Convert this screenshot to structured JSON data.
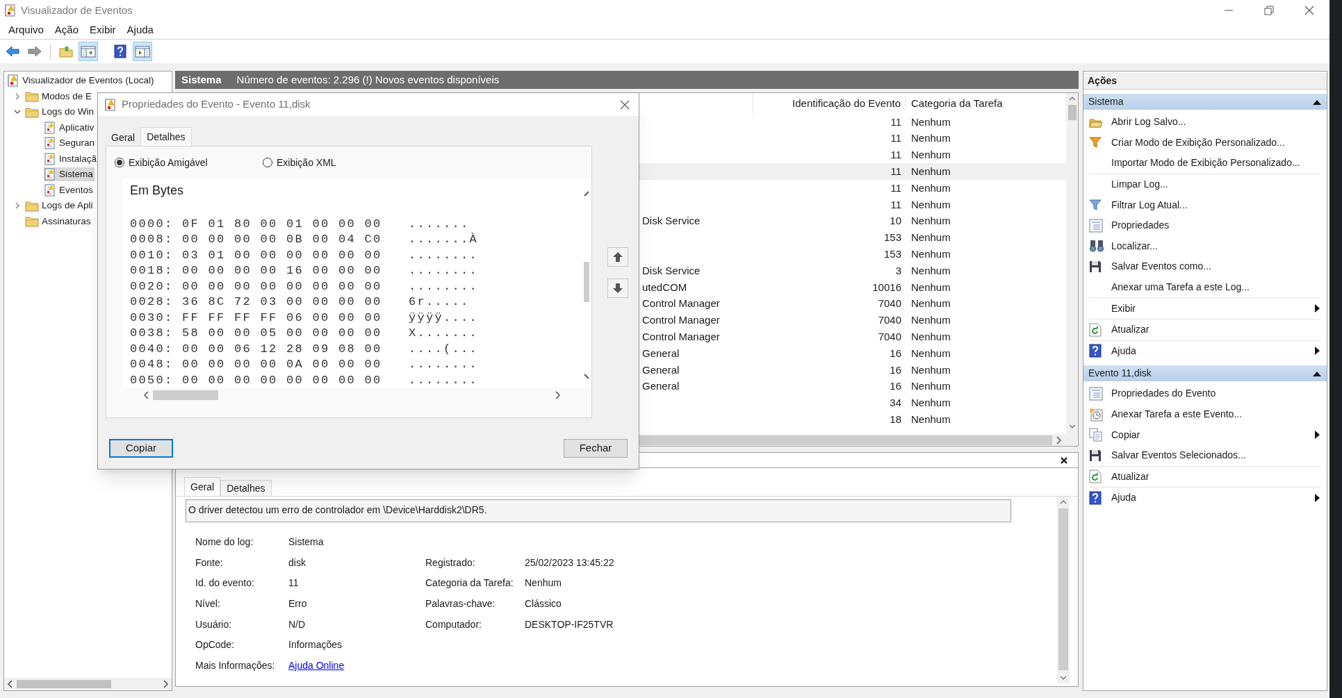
{
  "window": {
    "title": "Visualizador de Eventos"
  },
  "menu": [
    "Arquivo",
    "Ação",
    "Exibir",
    "Ajuda"
  ],
  "toolbar": [
    {
      "on": false
    },
    {
      "on": false
    },
    {
      "on": false
    },
    {
      "on": true
    },
    {
      "on": false
    },
    {
      "on": true
    }
  ],
  "tree": [
    {
      "label": "Visualizador de Eventos (Local)",
      "kind": "root",
      "selected": false,
      "children": [
        {
          "label": "Modos de E",
          "kind": "folder",
          "selected": false,
          "expanded": false
        },
        {
          "label": "Logs do Win",
          "kind": "folder",
          "selected": false,
          "expanded": true,
          "children": [
            {
              "label": "Aplicativ",
              "kind": "log",
              "selected": false
            },
            {
              "label": "Seguran",
              "kind": "log",
              "selected": false
            },
            {
              "label": "Instalaçã",
              "kind": "log",
              "selected": false
            },
            {
              "label": "Sistema",
              "kind": "log",
              "selected": true
            },
            {
              "label": "Eventos",
              "kind": "log",
              "selected": false
            }
          ]
        },
        {
          "label": "Logs de Apli",
          "kind": "folder",
          "selected": false,
          "expanded": false
        },
        {
          "label": "Assinaturas",
          "kind": "folder",
          "selected": false
        }
      ]
    }
  ],
  "log_header": {
    "name": "Sistema",
    "summary": "Número de eventos: 2.296 (!) Novos eventos disponíveis"
  },
  "table": {
    "columns": [
      {
        "label": "Identificação do Evento"
      },
      {
        "label": "Categoria da Tarefa"
      }
    ],
    "rows": [
      {
        "event_id": "11",
        "category": "Nenhum",
        "selected": false
      },
      {
        "event_id": "11",
        "category": "Nenhum",
        "selected": false
      },
      {
        "event_id": "11",
        "category": "Nenhum",
        "selected": false
      },
      {
        "event_id": "11",
        "category": "Nenhum",
        "selected": true
      },
      {
        "event_id": "11",
        "category": "Nenhum",
        "selected": false
      },
      {
        "event_id": "11",
        "category": "Nenhum",
        "selected": false
      },
      {
        "column_1": "Disk Service",
        "event_id": "10",
        "category": "Nenhum",
        "selected": false
      },
      {
        "event_id": "153",
        "category": "Nenhum",
        "selected": false
      },
      {
        "event_id": "153",
        "category": "Nenhum",
        "selected": false
      },
      {
        "column_1": "Disk Service",
        "event_id": "3",
        "category": "Nenhum",
        "selected": false
      },
      {
        "column_1": "utedCOM",
        "event_id": "10016",
        "category": "Nenhum",
        "selected": false
      },
      {
        "column_1": "Control Manager",
        "event_id": "7040",
        "category": "Nenhum",
        "selected": false
      },
      {
        "column_1": "Control Manager",
        "event_id": "7040",
        "category": "Nenhum",
        "selected": false
      },
      {
        "column_1": "Control Manager",
        "event_id": "7040",
        "category": "Nenhum",
        "selected": false
      },
      {
        "column_1": "General",
        "event_id": "16",
        "category": "Nenhum",
        "selected": false
      },
      {
        "column_1": "General",
        "event_id": "16",
        "category": "Nenhum",
        "selected": false
      },
      {
        "column_1": "General",
        "event_id": "16",
        "category": "Nenhum",
        "selected": false
      },
      {
        "event_id": "34",
        "category": "Nenhum",
        "selected": false
      },
      {
        "event_id": "18",
        "category": "Nenhum",
        "selected": false
      }
    ]
  },
  "detail": {
    "tabs": [
      {
        "label": "Geral",
        "selected": true
      },
      {
        "label": "Detalhes",
        "selected": false
      }
    ],
    "message": "O driver detectou um erro de controlador em \\Device\\Harddisk2\\DR5.",
    "rows": [
      {
        "label": "Nome do log:",
        "value": "Sistema"
      },
      {
        "label": "Fonte:",
        "value": "disk",
        "right_label": "Registrado:",
        "right_value": "25/02/2023 13:45:22"
      },
      {
        "label": "Id. do evento:",
        "value": "11",
        "right_label": "Categoria da Tarefa:",
        "right_value": "Nenhum"
      },
      {
        "label": "Nível:",
        "value": "Erro",
        "right_label": "Palavras-chave:",
        "right_value": "Clássico"
      },
      {
        "label": "Usuário:",
        "value": "N/D",
        "right_label": "Computador:",
        "right_value": "DESKTOP-IF25TVR"
      },
      {
        "label": "OpCode:",
        "value": "Informações"
      },
      {
        "label": "Mais Informações:",
        "link": "Ajuda Online"
      }
    ]
  },
  "actions": {
    "title": "Ações",
    "groups": [
      {
        "title": "Sistema",
        "expanded": true,
        "items": [
          {
            "label": "Abrir Log Salvo...",
            "submenu": false,
            "divider": false
          },
          {
            "label": "Criar Modo de Exibição Personalizado...",
            "submenu": false,
            "divider": false
          },
          {
            "label": "Importar Modo de Exibição Personalizado...",
            "submenu": false,
            "divider": false
          },
          {
            "label": "Limpar Log...",
            "submenu": false,
            "divider": true
          },
          {
            "label": "Filtrar Log Atual...",
            "submenu": false,
            "divider": false
          },
          {
            "label": "Propriedades",
            "submenu": false,
            "divider": false
          },
          {
            "label": "Localizar...",
            "submenu": false,
            "divider": false
          },
          {
            "label": "Salvar Eventos como...",
            "submenu": false,
            "divider": false
          },
          {
            "label": "Anexar uma Tarefa a este Log...",
            "submenu": false,
            "divider": false
          },
          {
            "label": "Exibir",
            "submenu": true,
            "divider": true
          },
          {
            "label": "Atualizar",
            "submenu": false,
            "divider": true
          },
          {
            "label": "Ajuda",
            "submenu": true,
            "divider": true
          }
        ]
      },
      {
        "title": "Evento 11,disk",
        "expanded": true,
        "items": [
          {
            "label": "Propriedades do Evento",
            "submenu": false,
            "divider": false
          },
          {
            "label": "Anexar Tarefa a este Evento...",
            "submenu": false,
            "divider": false
          },
          {
            "label": "Copiar",
            "submenu": true,
            "divider": false
          },
          {
            "label": "Salvar Eventos Selecionados...",
            "submenu": false,
            "divider": false
          },
          {
            "label": "Atualizar",
            "submenu": false,
            "divider": true
          },
          {
            "label": "Ajuda",
            "submenu": true,
            "divider": true
          }
        ]
      }
    ]
  },
  "dialog": {
    "title": "Propriedades do Evento - Evento 11,disk",
    "tabs": [
      {
        "label": "Geral",
        "selected": false
      },
      {
        "label": "Detalhes",
        "selected": true
      }
    ],
    "views": [
      {
        "label": "Exibição Amigável",
        "selected": true
      },
      {
        "label": "Exibição XML",
        "selected": false
      }
    ],
    "section_title": "Em Bytes",
    "hex_lines": [
      {
        "hex": "0000: 0F 01 80 00 01 00 00 00",
        "ascii": "......."
      },
      {
        "hex": "0008: 00 00 00 00 0B 00 04 C0",
        "ascii": ".......À"
      },
      {
        "hex": "0010: 03 01 00 00 00 00 00 00",
        "ascii": "........"
      },
      {
        "hex": "0018: 00 00 00 00 16 00 00 00",
        "ascii": "........"
      },
      {
        "hex": "0020: 00 00 00 00 00 00 00 00",
        "ascii": "........"
      },
      {
        "hex": "0028: 36 8C 72 03 00 00 00 00",
        "ascii": "6r....."
      },
      {
        "hex": "0030: FF FF FF FF 06 00 00 00",
        "ascii": "ÿÿÿÿ...."
      },
      {
        "hex": "0038: 58 00 00 05 00 00 00 00",
        "ascii": "X......."
      },
      {
        "hex": "0040: 00 00 06 12 28 09 08 00",
        "ascii": "....(..."
      },
      {
        "hex": "0048: 00 00 00 00 0A 00 00 00",
        "ascii": "........"
      },
      {
        "hex": "0050: 00 00 00 00 00 00 00 00",
        "ascii": "........"
      }
    ],
    "buttons": [
      {
        "label": "Copiar",
        "focused": true
      },
      {
        "label": "Fechar",
        "focused": false
      }
    ]
  }
}
